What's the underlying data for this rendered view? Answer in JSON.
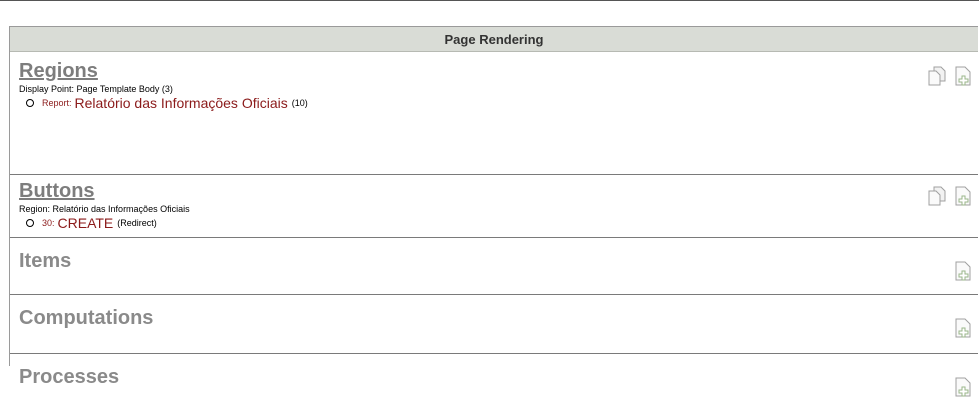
{
  "header": {
    "title": "Page Rendering"
  },
  "regions": {
    "title": "Regions",
    "display_point": "Display Point: Page Template Body (3)",
    "entry": {
      "prefix": "Report:",
      "name": "Relatório das Informações Oficiais",
      "count": "(10)"
    }
  },
  "buttons": {
    "title": "Buttons",
    "region": "Region: Relatório das Informações Oficiais",
    "entry": {
      "prefix": "30:",
      "name": "CREATE",
      "suffix": "(Redirect)"
    }
  },
  "items": {
    "title": "Items"
  },
  "computations": {
    "title": "Computations"
  },
  "processes": {
    "title": "Processes"
  },
  "icons": {
    "copy": "copy-icon",
    "add": "add-icon"
  }
}
